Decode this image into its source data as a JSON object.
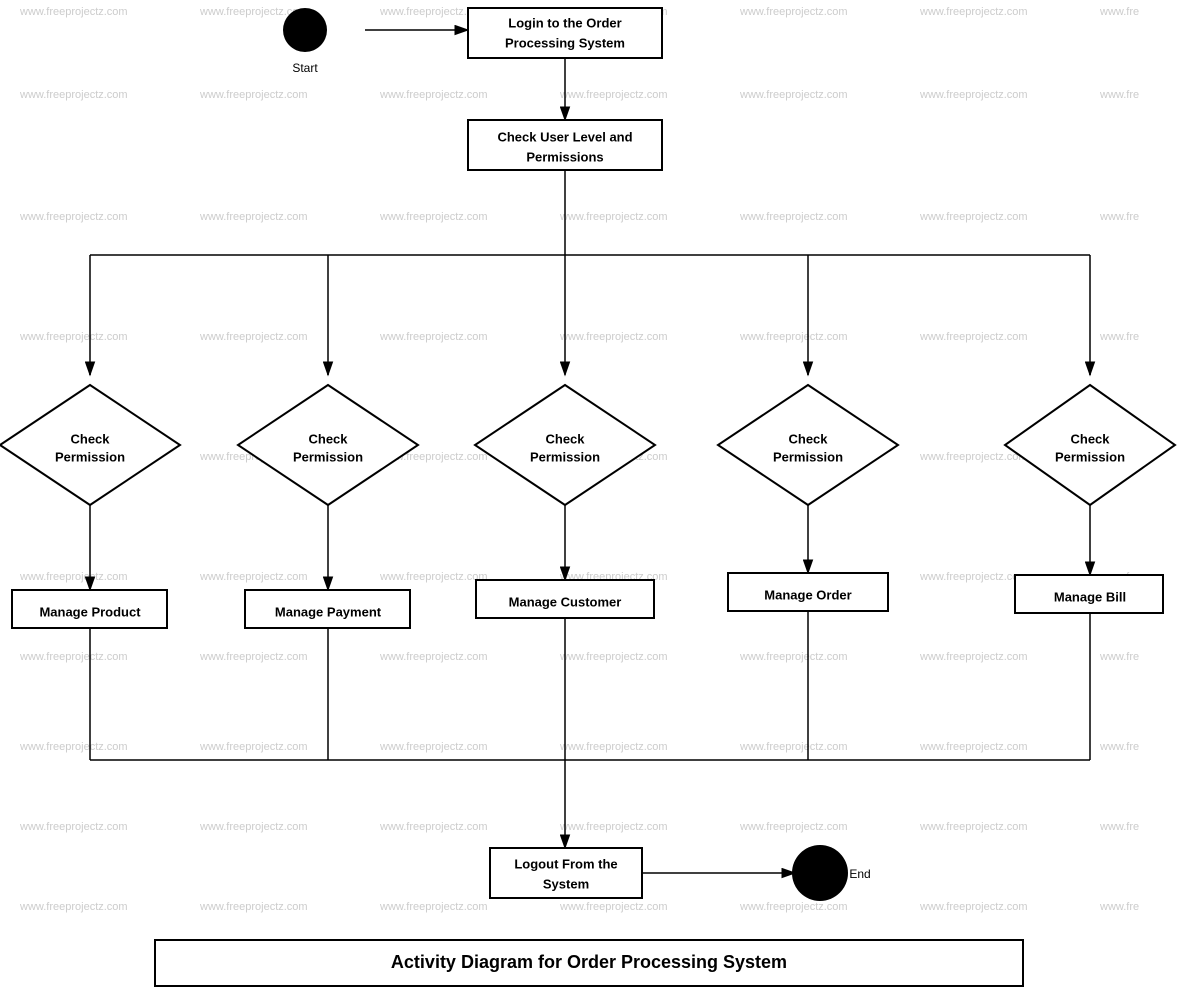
{
  "title": "Activity Diagram for Order Processing System",
  "nodes": {
    "start": {
      "label": "Start"
    },
    "login": {
      "label": "Login to the Order Processing System"
    },
    "checkUserLevel": {
      "label": "Check User Level and Permissions"
    },
    "checkPermission1": {
      "label": "Check Permission"
    },
    "checkPermission2": {
      "label": "Check Permission"
    },
    "checkPermission3": {
      "label": "Check Permission"
    },
    "checkPermission4": {
      "label": "Check Permission"
    },
    "checkPermission5": {
      "label": "Check Permission"
    },
    "manageProduct": {
      "label": "Manage Product"
    },
    "managePayment": {
      "label": "Manage Payment"
    },
    "manageCustomer": {
      "label": "Manage Customer"
    },
    "manageOrder": {
      "label": "Manage Order"
    },
    "manageBill": {
      "label": "Manage Bill"
    },
    "logout": {
      "label": "Logout From the System"
    },
    "end": {
      "label": "End"
    }
  },
  "watermark": "www.freeprojectz.com"
}
